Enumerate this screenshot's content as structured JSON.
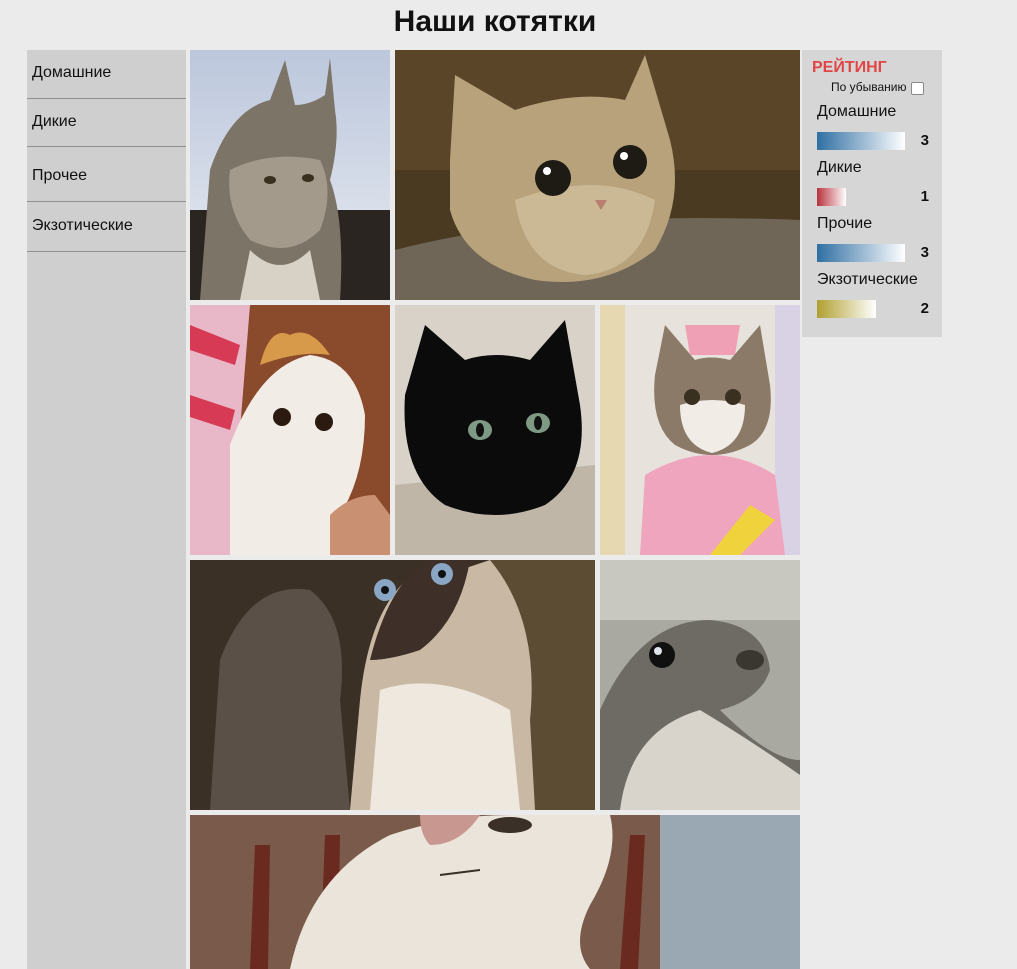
{
  "page": {
    "title": "Наши котятки"
  },
  "sidebar": {
    "items": [
      {
        "label": "Домашние"
      },
      {
        "label": "Дикие"
      },
      {
        "label": "Прочее"
      },
      {
        "label": "Экзотические"
      }
    ]
  },
  "gallery": {
    "photos": [
      {
        "subject": "lynx"
      },
      {
        "subject": "british-shorthair-kitten"
      },
      {
        "subject": "exotic-shorthair-kitten"
      },
      {
        "subject": "black-fluffy-kitten"
      },
      {
        "subject": "cat-in-pink-costume"
      },
      {
        "subject": "siamese-cat-with-tabby"
      },
      {
        "subject": "seal-pup"
      },
      {
        "subject": "cream-cat-closeup"
      }
    ]
  },
  "rating": {
    "title": "РЕЙТИНГ",
    "sort_label": "По убыванию",
    "sort_checked": false,
    "max": 3,
    "items": [
      {
        "label": "Домашние",
        "count": "3",
        "value": 3,
        "color": "#2f6fa3"
      },
      {
        "label": "Дикие",
        "count": "1",
        "value": 1,
        "color": "#b8323d"
      },
      {
        "label": "Прочие",
        "count": "3",
        "value": 3,
        "color": "#2f6fa3"
      },
      {
        "label": "Экзотические",
        "count": "2",
        "value": 2,
        "color": "#b0a030"
      }
    ]
  }
}
